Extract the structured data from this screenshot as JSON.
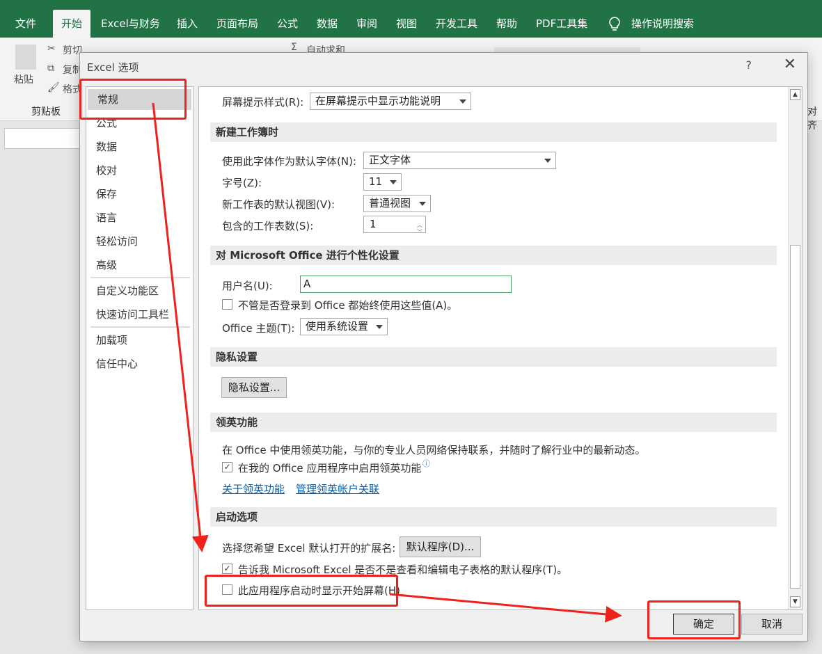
{
  "ribbon": {
    "tabs": [
      "文件",
      "开始",
      "Excel与财务",
      "插入",
      "页面布局",
      "公式",
      "数据",
      "审阅",
      "视图",
      "开发工具",
      "帮助",
      "PDF工具集"
    ],
    "active_tab": "开始",
    "search_label": "操作说明搜索",
    "clipboard": {
      "paste": "粘贴",
      "cut": "剪切",
      "copy": "复制",
      "format": "格式",
      "group": "剪贴板"
    },
    "autosum": "自动求和",
    "align_partial": "对齐"
  },
  "dialog": {
    "title": "Excel 选项",
    "help": "?",
    "close": "✕",
    "nav": [
      "常规",
      "公式",
      "数据",
      "校对",
      "保存",
      "语言",
      "轻松访问",
      "高级",
      "自定义功能区",
      "快速访问工具栏",
      "加载项",
      "信任中心"
    ],
    "selected": "常规",
    "tooltip_style": {
      "label": "屏幕提示样式(R):",
      "value": "在屏幕提示中显示功能说明"
    },
    "new_workbook": {
      "header": "新建工作簿时",
      "font_label": "使用此字体作为默认字体(N):",
      "font_value": "正文字体",
      "size_label": "字号(Z):",
      "size_value": "11",
      "view_label": "新工作表的默认视图(V):",
      "view_value": "普通视图",
      "sheets_label": "包含的工作表数(S):",
      "sheets_value": "1"
    },
    "personalize": {
      "header": "对 Microsoft Office 进行个性化设置",
      "username_label": "用户名(U):",
      "username_value": "A",
      "always_use_label": "不管是否登录到 Office 都始终使用这些值(A)。",
      "always_use_checked": false,
      "theme_label": "Office 主题(T):",
      "theme_value": "使用系统设置"
    },
    "privacy": {
      "header": "隐私设置",
      "button": "隐私设置..."
    },
    "linkedin": {
      "header": "领英功能",
      "description": "在 Office 中使用领英功能，与你的专业人员网络保持联系，并随时了解行业中的最新动态。",
      "enable_label": "在我的 Office 应用程序中启用领英功能",
      "enable_checked": true,
      "about_link": "关于领英功能",
      "manage_link": "管理领英帐户关联"
    },
    "startup": {
      "header": "启动选项",
      "ext_label": "选择您希望 Excel 默认打开的扩展名:",
      "default_programs_button": "默认程序(D)...",
      "tell_me_label": "告诉我 Microsoft Excel 是否不是查看和编辑电子表格的默认程序(T)。",
      "tell_me_checked": true,
      "show_start_label": "此应用程序启动时显示开始屏幕(H)",
      "show_start_checked": false
    },
    "ok": "确定",
    "cancel": "取消"
  },
  "colors": {
    "excel_green": "#217346",
    "annotation_red": "#f0201a",
    "link_blue": "#0b5da8"
  }
}
